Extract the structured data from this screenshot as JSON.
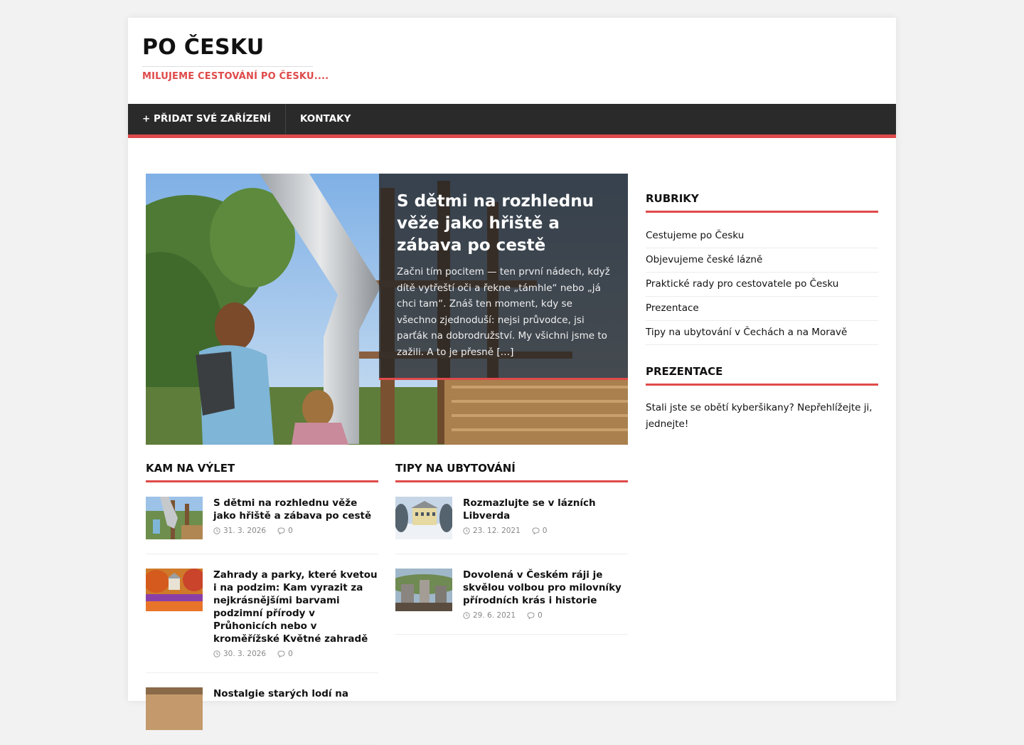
{
  "site": {
    "title": "PO ČESKU",
    "description": "MILUJEME CESTOVÁNÍ PO ČESKU...."
  },
  "nav": {
    "items": [
      "+ PŘIDAT SVÉ ZAŘÍZENÍ",
      "KONTAKY"
    ]
  },
  "hero": {
    "title": "S dětmi na rozhlednu věže jako hřiště a zábava po cestě",
    "excerpt": "Začni tím pocitem — ten první nádech, když dítě vytřeští oči a řekne „támhle“ nebo „já chci tam“. Znáš ten moment, kdy se všechno zjednoduší: nejsi průvodce, jsi parťák na dobrodružství. My všichni jsme to zažili. A to je přesně ",
    "more": "[…]"
  },
  "sections": [
    {
      "title": "KAM NA VÝLET",
      "posts": [
        {
          "title": "S dětmi na rozhlednu věže jako hřiště a zábava po cestě",
          "date": "31. 3. 2026",
          "comments": "0"
        },
        {
          "title": "Zahrady a parky, které kvetou i na podzim: Kam vyrazit za nejkrásnějšími barvami podzimní přírody v Průhonicích nebo v kroměřížské Květné zahradě",
          "date": "30. 3. 2026",
          "comments": "0"
        },
        {
          "title": "Nostalgie starých lodí na",
          "date": "",
          "comments": ""
        }
      ]
    },
    {
      "title": "TIPY NA UBYTOVÁNÍ",
      "posts": [
        {
          "title": "Rozmazlujte se v lázních Libverda",
          "date": "23. 12. 2021",
          "comments": "0"
        },
        {
          "title": "Dovolená v Českém ráji je skvělou volbou pro milovníky přírodních krás i historie",
          "date": "29. 6. 2021",
          "comments": "0"
        }
      ]
    }
  ],
  "sidebar": {
    "categories_title": "RUBRIKY",
    "categories": [
      "Cestujeme po Česku",
      "Objevujeme české lázně",
      "Praktické rady pro cestovatele po Česku",
      "Prezentace",
      "Tipy na ubytování v Čechách a na Moravě"
    ],
    "prezentace_title": "PREZENTACE",
    "prezentace_text": "Stali jste se obětí kyberšikany? Nepřehlížejte ji, jednejte!"
  },
  "colors": {
    "accent": "#df4a4a",
    "nav_bg": "#2a2a2a"
  }
}
